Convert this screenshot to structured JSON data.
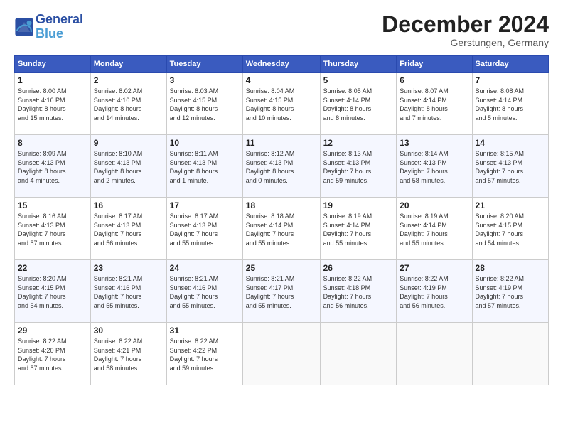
{
  "header": {
    "logo_line1": "General",
    "logo_line2": "Blue",
    "month_title": "December 2024",
    "location": "Gerstungen, Germany"
  },
  "weekdays": [
    "Sunday",
    "Monday",
    "Tuesday",
    "Wednesday",
    "Thursday",
    "Friday",
    "Saturday"
  ],
  "weeks": [
    [
      {
        "day": "1",
        "info": "Sunrise: 8:00 AM\nSunset: 4:16 PM\nDaylight: 8 hours\nand 15 minutes."
      },
      {
        "day": "2",
        "info": "Sunrise: 8:02 AM\nSunset: 4:16 PM\nDaylight: 8 hours\nand 14 minutes."
      },
      {
        "day": "3",
        "info": "Sunrise: 8:03 AM\nSunset: 4:15 PM\nDaylight: 8 hours\nand 12 minutes."
      },
      {
        "day": "4",
        "info": "Sunrise: 8:04 AM\nSunset: 4:15 PM\nDaylight: 8 hours\nand 10 minutes."
      },
      {
        "day": "5",
        "info": "Sunrise: 8:05 AM\nSunset: 4:14 PM\nDaylight: 8 hours\nand 8 minutes."
      },
      {
        "day": "6",
        "info": "Sunrise: 8:07 AM\nSunset: 4:14 PM\nDaylight: 8 hours\nand 7 minutes."
      },
      {
        "day": "7",
        "info": "Sunrise: 8:08 AM\nSunset: 4:14 PM\nDaylight: 8 hours\nand 5 minutes."
      }
    ],
    [
      {
        "day": "8",
        "info": "Sunrise: 8:09 AM\nSunset: 4:13 PM\nDaylight: 8 hours\nand 4 minutes."
      },
      {
        "day": "9",
        "info": "Sunrise: 8:10 AM\nSunset: 4:13 PM\nDaylight: 8 hours\nand 2 minutes."
      },
      {
        "day": "10",
        "info": "Sunrise: 8:11 AM\nSunset: 4:13 PM\nDaylight: 8 hours\nand 1 minute."
      },
      {
        "day": "11",
        "info": "Sunrise: 8:12 AM\nSunset: 4:13 PM\nDaylight: 8 hours\nand 0 minutes."
      },
      {
        "day": "12",
        "info": "Sunrise: 8:13 AM\nSunset: 4:13 PM\nDaylight: 7 hours\nand 59 minutes."
      },
      {
        "day": "13",
        "info": "Sunrise: 8:14 AM\nSunset: 4:13 PM\nDaylight: 7 hours\nand 58 minutes."
      },
      {
        "day": "14",
        "info": "Sunrise: 8:15 AM\nSunset: 4:13 PM\nDaylight: 7 hours\nand 57 minutes."
      }
    ],
    [
      {
        "day": "15",
        "info": "Sunrise: 8:16 AM\nSunset: 4:13 PM\nDaylight: 7 hours\nand 57 minutes."
      },
      {
        "day": "16",
        "info": "Sunrise: 8:17 AM\nSunset: 4:13 PM\nDaylight: 7 hours\nand 56 minutes."
      },
      {
        "day": "17",
        "info": "Sunrise: 8:17 AM\nSunset: 4:13 PM\nDaylight: 7 hours\nand 55 minutes."
      },
      {
        "day": "18",
        "info": "Sunrise: 8:18 AM\nSunset: 4:14 PM\nDaylight: 7 hours\nand 55 minutes."
      },
      {
        "day": "19",
        "info": "Sunrise: 8:19 AM\nSunset: 4:14 PM\nDaylight: 7 hours\nand 55 minutes."
      },
      {
        "day": "20",
        "info": "Sunrise: 8:19 AM\nSunset: 4:14 PM\nDaylight: 7 hours\nand 55 minutes."
      },
      {
        "day": "21",
        "info": "Sunrise: 8:20 AM\nSunset: 4:15 PM\nDaylight: 7 hours\nand 54 minutes."
      }
    ],
    [
      {
        "day": "22",
        "info": "Sunrise: 8:20 AM\nSunset: 4:15 PM\nDaylight: 7 hours\nand 54 minutes."
      },
      {
        "day": "23",
        "info": "Sunrise: 8:21 AM\nSunset: 4:16 PM\nDaylight: 7 hours\nand 55 minutes."
      },
      {
        "day": "24",
        "info": "Sunrise: 8:21 AM\nSunset: 4:16 PM\nDaylight: 7 hours\nand 55 minutes."
      },
      {
        "day": "25",
        "info": "Sunrise: 8:21 AM\nSunset: 4:17 PM\nDaylight: 7 hours\nand 55 minutes."
      },
      {
        "day": "26",
        "info": "Sunrise: 8:22 AM\nSunset: 4:18 PM\nDaylight: 7 hours\nand 56 minutes."
      },
      {
        "day": "27",
        "info": "Sunrise: 8:22 AM\nSunset: 4:19 PM\nDaylight: 7 hours\nand 56 minutes."
      },
      {
        "day": "28",
        "info": "Sunrise: 8:22 AM\nSunset: 4:19 PM\nDaylight: 7 hours\nand 57 minutes."
      }
    ],
    [
      {
        "day": "29",
        "info": "Sunrise: 8:22 AM\nSunset: 4:20 PM\nDaylight: 7 hours\nand 57 minutes."
      },
      {
        "day": "30",
        "info": "Sunrise: 8:22 AM\nSunset: 4:21 PM\nDaylight: 7 hours\nand 58 minutes."
      },
      {
        "day": "31",
        "info": "Sunrise: 8:22 AM\nSunset: 4:22 PM\nDaylight: 7 hours\nand 59 minutes."
      },
      null,
      null,
      null,
      null
    ]
  ]
}
